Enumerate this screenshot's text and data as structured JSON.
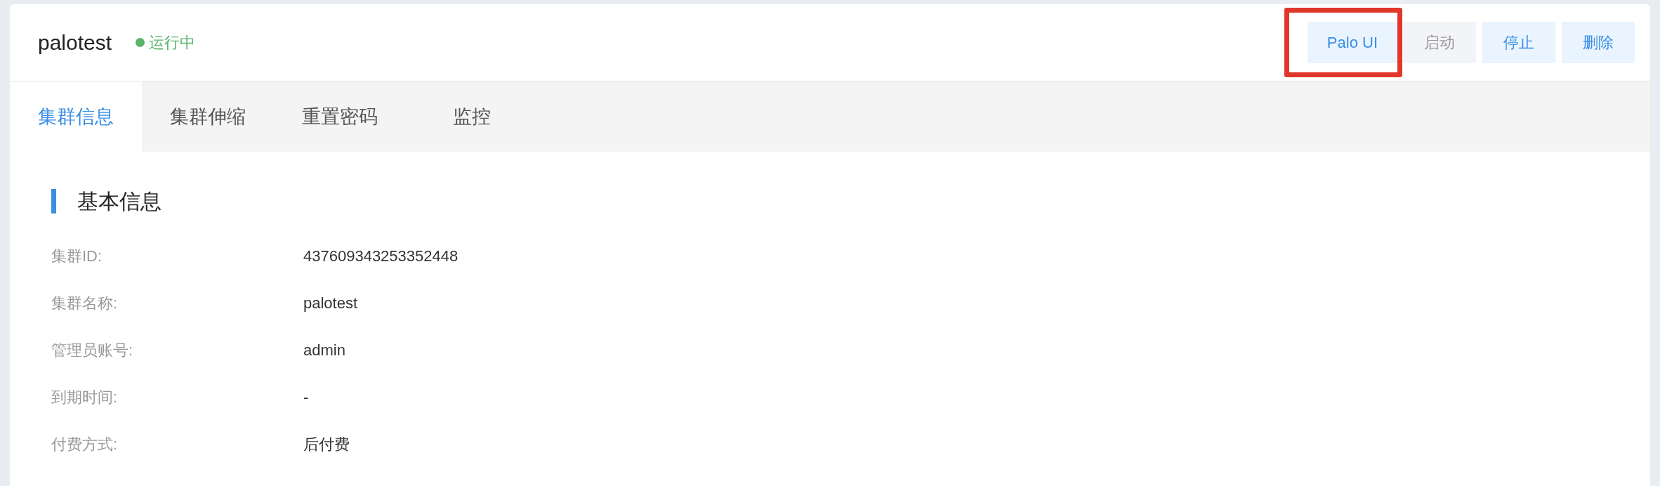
{
  "header": {
    "title": "palotest",
    "status": {
      "label": "运行中",
      "color": "#5cb46c"
    }
  },
  "actions": [
    {
      "label": "Palo UI",
      "disabled": false,
      "highlighted": true
    },
    {
      "label": "启动",
      "disabled": true,
      "highlighted": false
    },
    {
      "label": "停止",
      "disabled": false,
      "highlighted": false
    },
    {
      "label": "删除",
      "disabled": false,
      "highlighted": false
    }
  ],
  "tabs": [
    {
      "label": "集群信息",
      "selected": true
    },
    {
      "label": "集群伸缩",
      "selected": false
    },
    {
      "label": "重置密码",
      "selected": false
    },
    {
      "label": "监控",
      "selected": false
    }
  ],
  "section": {
    "title": "基本信息",
    "fields": [
      {
        "label": "集群ID:",
        "value": "437609343253352448"
      },
      {
        "label": "集群名称:",
        "value": "palotest"
      },
      {
        "label": "管理员账号:",
        "value": "admin"
      },
      {
        "label": "到期时间:",
        "value": "-"
      },
      {
        "label": "付费方式:",
        "value": "后付费"
      }
    ]
  }
}
